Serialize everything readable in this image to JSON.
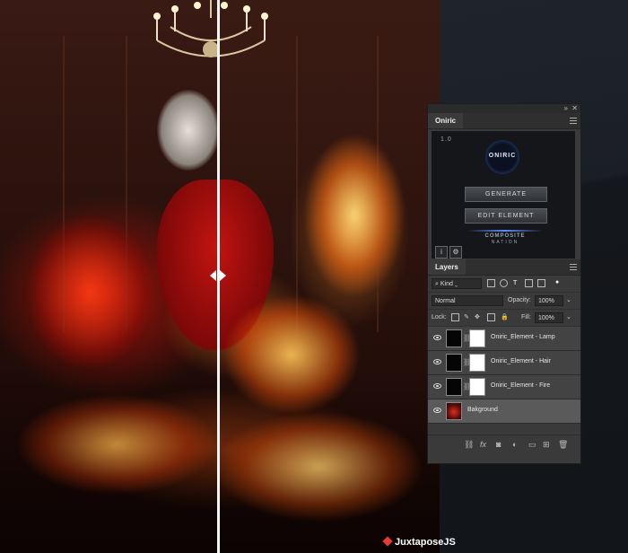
{
  "watermark": "JuxtaposeJS",
  "oniric_panel": {
    "tab_label": "Oniric",
    "version": "1.0",
    "logo_text": "ONIRIC",
    "generate_label": "GENERATE",
    "edit_label": "EDIT ELEMENT",
    "brand_line1": "COMPOSITE",
    "brand_line2": "NATION",
    "info_icon": "i"
  },
  "layers_panel": {
    "tab_label": "Layers",
    "filter_kind": "Kind",
    "blend_mode": "Normal",
    "opacity_label": "Opacity:",
    "opacity_value": "100%",
    "lock_label": "Lock:",
    "fill_label": "Fill:",
    "fill_value": "100%",
    "layers": [
      {
        "name": "Oniric_Element - Lamp"
      },
      {
        "name": "Oniric_Element - Hair"
      },
      {
        "name": "Oniric_Element - Fire"
      },
      {
        "name": "Bakground"
      }
    ],
    "bottom_icons": [
      "link-icon",
      "fx-icon",
      "mask-icon",
      "adjustment-icon",
      "group-icon",
      "new-layer-icon",
      "trash-icon"
    ],
    "fx_label": "fx"
  },
  "colors": {
    "panel_bg": "#3a3a3a",
    "selected_layer": "#5a5a5a",
    "accent_blue": "#5f8dff",
    "watermark_dot": "#e23b3b"
  }
}
